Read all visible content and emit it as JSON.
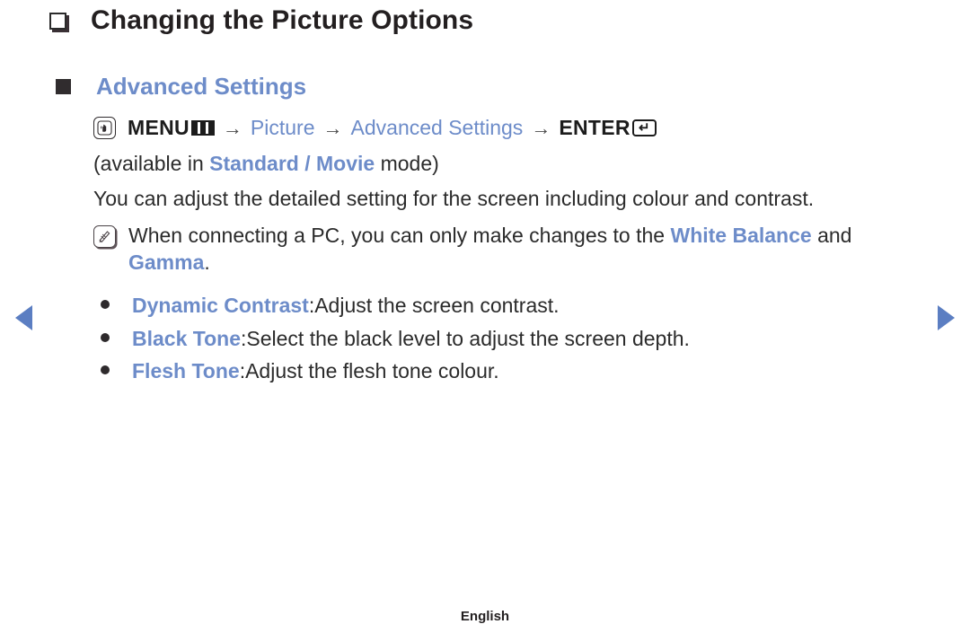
{
  "page": {
    "title": "Changing the Picture Options",
    "title_bullet_icon": "hollow-square-bullet-icon"
  },
  "section": {
    "heading": "Advanced Settings",
    "heading_bullet_icon": "filled-square-bullet-icon"
  },
  "menu_path": {
    "hand_icon": "hand-press-icon",
    "menu_label": "MENU",
    "menu_glyph_icon": "menu-bars-icon",
    "arrow1": "→",
    "item1": "Picture",
    "arrow2": "→",
    "item2": "Advanced Settings",
    "arrow3": "→",
    "enter_label": "ENTER",
    "enter_glyph_icon": "enter-return-icon",
    "enter_glyph": "↵"
  },
  "availability": {
    "prefix": "(available in ",
    "modes": "Standard / Movie",
    "suffix": " mode)"
  },
  "description": "You can adjust the detailed setting for the screen including colour and contrast.",
  "note": {
    "icon": "note-pencil-icon",
    "text_part1": "When connecting a PC, you can only make changes to the ",
    "highlight1": "White Balance",
    "text_part2": " and ",
    "highlight2": "Gamma",
    "text_part3": "."
  },
  "options": [
    {
      "bullet_icon": "round-bullet-icon",
      "term": "Dynamic Contrast",
      "separator": ": ",
      "desc": "Adjust the screen contrast."
    },
    {
      "bullet_icon": "round-bullet-icon",
      "term": "Black Tone",
      "separator": ": ",
      "desc": "Select the black level to adjust the screen depth."
    },
    {
      "bullet_icon": "round-bullet-icon",
      "term": "Flesh Tone",
      "separator": ": ",
      "desc": "Adjust the flesh tone colour."
    }
  ],
  "navigation": {
    "prev_icon": "previous-page-arrow-icon",
    "next_icon": "next-page-arrow-icon"
  },
  "footer": {
    "language": "English"
  },
  "colors": {
    "accent_blue": "#6d8cc9",
    "nav_blue": "#5b7ec2",
    "text_dark": "#2b2b2b"
  }
}
